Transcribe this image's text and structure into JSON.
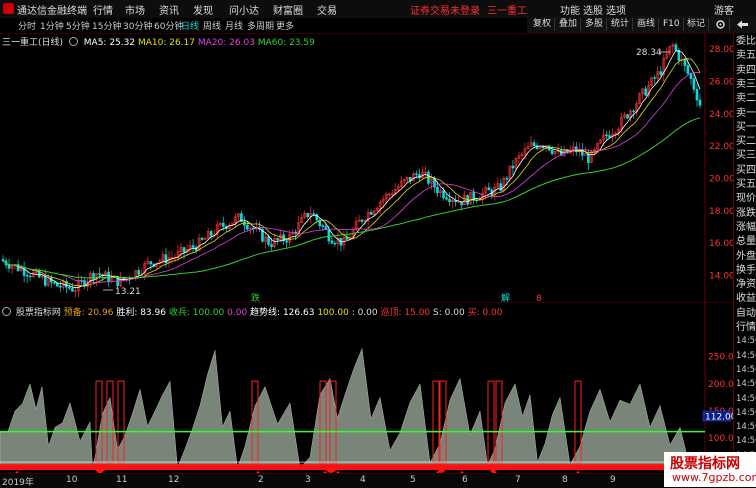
{
  "app": {
    "name": "通达信金融终端",
    "menus": [
      "行情",
      "市场",
      "资讯",
      "发现",
      "问小达",
      "财富圈",
      "交易"
    ],
    "login_notice": "证券交易未登录",
    "stock_title": "三一重工",
    "right_menus": [
      "功能",
      "选股",
      "选项",
      "游客"
    ]
  },
  "periods": [
    "分时",
    "1分钟",
    "5分钟",
    "15分钟",
    "30分钟",
    "60分钟",
    "日线",
    "周线",
    "月线",
    "多周期",
    "更多"
  ],
  "active_period": "日线",
  "toolbar": [
    "复权",
    "叠加",
    "多股",
    "统计",
    "画线",
    "F10",
    "标记"
  ],
  "toolbar_icons": [
    "settings-icon",
    "back-icon"
  ],
  "main_info": {
    "title": "三一重工(日线)",
    "ma5": "MA5: 25.32",
    "ma10": "MA10: 26.17",
    "ma20": "MA20: 26.03",
    "ma60": "MA60: 23.59"
  },
  "price_axis": [
    "28.00",
    "26.00",
    "24.00",
    "22.00",
    "20.00",
    "18.00",
    "16.00",
    "14.00"
  ],
  "annotations": {
    "high": "28.34",
    "low": "13.21",
    "marker_1": "跌",
    "marker_2": "解",
    "marker_3": "8"
  },
  "sub_info": {
    "title": "股票指标网",
    "t1": "预备: 20.96",
    "t2": "胜利: 83.96",
    "t3": "收兵: 100.00",
    "t4": "0.00",
    "t5": "趋势线: 126.63",
    "t6": "100.00",
    "t7": ": 0.00",
    "t8": "巡顶: 15.00",
    "t9": "S: 0.00",
    "t10": "买: 0.00"
  },
  "sub_axis": [
    "250.0",
    "200.0",
    "150.0",
    "100.0",
    "50.00"
  ],
  "sub_axis_highlight": "112.00",
  "right_panel": [
    "委比",
    "卖五",
    "卖四",
    "卖三",
    "卖二",
    "卖一",
    "买一",
    "买二",
    "买三",
    "买四",
    "买五",
    "现价",
    "涨跌",
    "涨幅",
    "总量",
    "外盘",
    "换手",
    "净资",
    "收益",
    "自动",
    "行情",
    "14:50",
    "14:50",
    "14:50",
    "14:50",
    "14:50",
    "14:50",
    "14:50",
    "14:50",
    "14:50"
  ],
  "date_labels": [
    "2019年",
    "10",
    "11",
    "12",
    "2",
    "3",
    "4",
    "5",
    "6",
    "7",
    "8",
    "9"
  ],
  "watermark": {
    "line1": "股票指标网",
    "line2": "www.7gpzb.com"
  },
  "colors": {
    "up": "#ff3030",
    "down": "#00e0e0",
    "ma5": "#ffffff",
    "ma10": "#e0e000",
    "ma20": "#e040e0",
    "ma60": "#30d030"
  }
}
